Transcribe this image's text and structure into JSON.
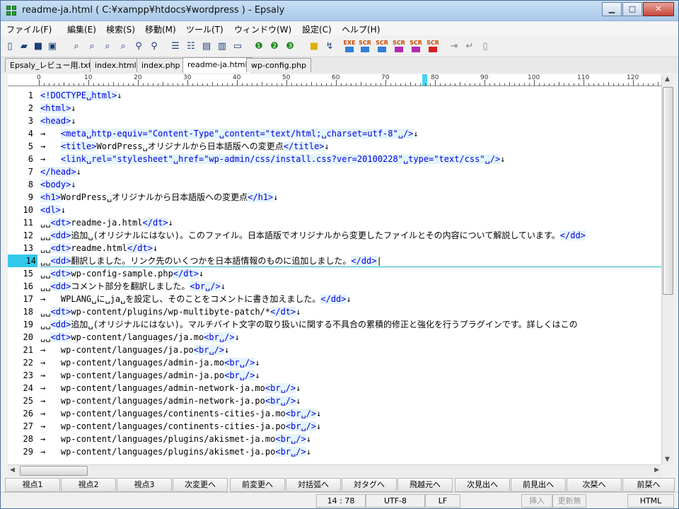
{
  "window": {
    "title": "readme-ja.html ( C:¥xampp¥htdocs¥wordpress ) - Epsaly"
  },
  "menu": [
    "ファイル(F)",
    "編集(E)",
    "検索(S)",
    "移動(M)",
    "ツール(T)",
    "ウィンドウ(W)",
    "設定(C)",
    "ヘルプ(H)"
  ],
  "toolbar": {
    "exe_label": "EXE",
    "scr_label": "SCR"
  },
  "tabs": [
    "Epsaly_レビュー用.txt",
    "index.html",
    "index.php",
    "readme-ja.html",
    "wp-config.php"
  ],
  "active_tab": "readme-ja.html",
  "ruler": [
    "0",
    "10",
    "20",
    "30",
    "40",
    "50",
    "60",
    "70",
    "80",
    "90",
    "100",
    "110",
    "120"
  ],
  "editor": {
    "current_line": 14,
    "lines": [
      {
        "n": "1",
        "t": "<!DOCTYPE␣html>↓"
      },
      {
        "n": "2",
        "t": "<html>↓"
      },
      {
        "n": "3",
        "t": "<head>↓"
      },
      {
        "n": "4",
        "t": "→   <meta␣http-equiv=\"Content-Type\"␣content=\"text/html;␣charset=utf-8\"␣/>↓"
      },
      {
        "n": "5",
        "t": "→   <title>WordPress␣オリジナルから日本語版への変更点</title>↓"
      },
      {
        "n": "6",
        "t": "→   <link␣rel=\"stylesheet\"␣href=\"wp-admin/css/install.css?ver=20100228\"␣type=\"text/css\"␣/>↓"
      },
      {
        "n": "7",
        "t": "</head>↓"
      },
      {
        "n": "8",
        "t": "<body>↓"
      },
      {
        "n": "9",
        "t": "<h1>WordPress␣オリジナルから日本語版への変更点</h1>↓"
      },
      {
        "n": "10",
        "t": "<dl>↓"
      },
      {
        "n": "11",
        "t": "␣␣<dt>readme-ja.html</dt>↓"
      },
      {
        "n": "12",
        "t": "␣␣<dd>追加␣(オリジナルにはない)。このファイル。日本語版でオリジナルから変更したファイルとその内容について解説しています。</dd>"
      },
      {
        "n": "13",
        "t": "␣␣<dt>readme.html</dt>↓"
      },
      {
        "n": "14",
        "t": "␣␣<dd>翻訳しました。リンク先のいくつかを日本語情報のものに追加しました。</dd>|"
      },
      {
        "n": "15",
        "t": "␣␣<dt>wp-config-sample.php</dt>↓"
      },
      {
        "n": "16",
        "t": "␣␣<dd>コメント部分を翻訳しました。<br␣/>↓"
      },
      {
        "n": "17",
        "t": "→   WPLANG␣に␣ja␣を設定し、そのことをコメントに書き加えました。</dd>↓"
      },
      {
        "n": "18",
        "t": "␣␣<dt>wp-content/plugins/wp-multibyte-patch/*</dt>↓"
      },
      {
        "n": "19",
        "t": "␣␣<dd>追加␣(オリジナルにはない)。マルチバイト文字の取り扱いに関する不具合の累積的修正と強化を行うプラグインです。詳しくはこの"
      },
      {
        "n": "20",
        "t": "␣␣<dt>wp-content/languages/ja.mo<br␣/>↓"
      },
      {
        "n": "21",
        "t": "→   wp-content/languages/ja.po<br␣/>↓"
      },
      {
        "n": "22",
        "t": "→   wp-content/languages/admin-ja.mo<br␣/>↓"
      },
      {
        "n": "23",
        "t": "→   wp-content/languages/admin-ja.po<br␣/>↓"
      },
      {
        "n": "24",
        "t": "→   wp-content/languages/admin-network-ja.mo<br␣/>↓"
      },
      {
        "n": "25",
        "t": "→   wp-content/languages/admin-network-ja.po<br␣/>↓"
      },
      {
        "n": "26",
        "t": "→   wp-content/languages/continents-cities-ja.mo<br␣/>↓"
      },
      {
        "n": "27",
        "t": "→   wp-content/languages/continents-cities-ja.po<br␣/>↓"
      },
      {
        "n": "28",
        "t": "→   wp-content/languages/plugins/akismet-ja.mo<br␣/>↓"
      },
      {
        "n": "29",
        "t": "→   wp-content/languages/plugins/akismet-ja.po<br␣/>↓"
      }
    ]
  },
  "fnkeys": [
    "視点1",
    "視点2",
    "視点3",
    "次変更へ",
    "前変更へ",
    "対括弧へ",
    "対タグへ",
    "飛越元へ",
    "次見出へ",
    "前見出へ",
    "次栞へ",
    "前栞へ"
  ],
  "status": {
    "position": "14 : 78",
    "encoding": "UTF-8",
    "newline": "LF",
    "insert": "挿入",
    "modified": "更新無",
    "mode": "HTML"
  }
}
